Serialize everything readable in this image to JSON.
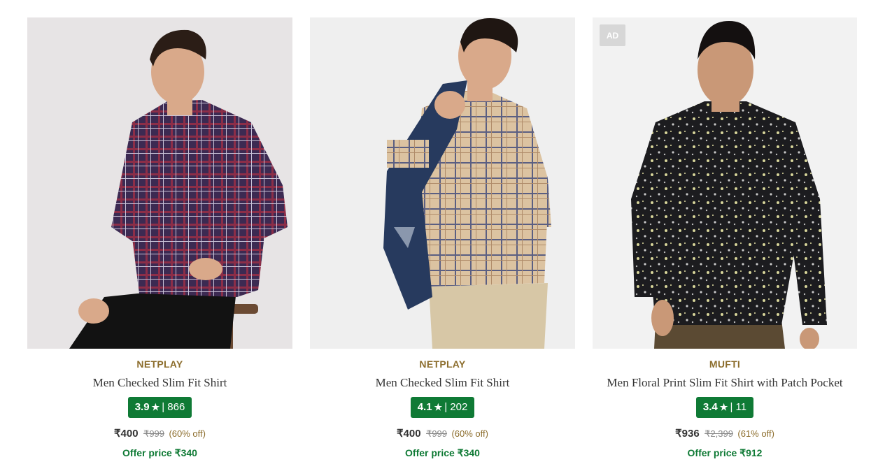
{
  "products": [
    {
      "brand": "NETPLAY",
      "name": "Men Checked Slim Fit Shirt",
      "rating": "3.9",
      "rating_star_icon": "star-icon",
      "rating_count": "| 866",
      "price": "₹400",
      "mrp": "₹999",
      "discount": "(60% off)",
      "offer": "Offer price ₹340",
      "ad_label": ""
    },
    {
      "brand": "NETPLAY",
      "name": "Men Checked Slim Fit Shirt",
      "rating": "4.1",
      "rating_star_icon": "star-icon",
      "rating_count": "| 202",
      "price": "₹400",
      "mrp": "₹999",
      "discount": "(60% off)",
      "offer": "Offer price ₹340",
      "ad_label": ""
    },
    {
      "brand": "MUFTI",
      "name": "Men Floral Print Slim Fit Shirt with Patch Pocket",
      "rating": "3.4",
      "rating_star_icon": "star-icon",
      "rating_count": "| 11",
      "price": "₹936",
      "mrp": "₹2,399",
      "discount": "(61% off)",
      "offer": "Offer price ₹912",
      "ad_label": "AD"
    }
  ],
  "colors": {
    "brand_text": "#8c6d2c",
    "rating_badge": "#0f7a35",
    "offer_text": "#0f7a35"
  }
}
